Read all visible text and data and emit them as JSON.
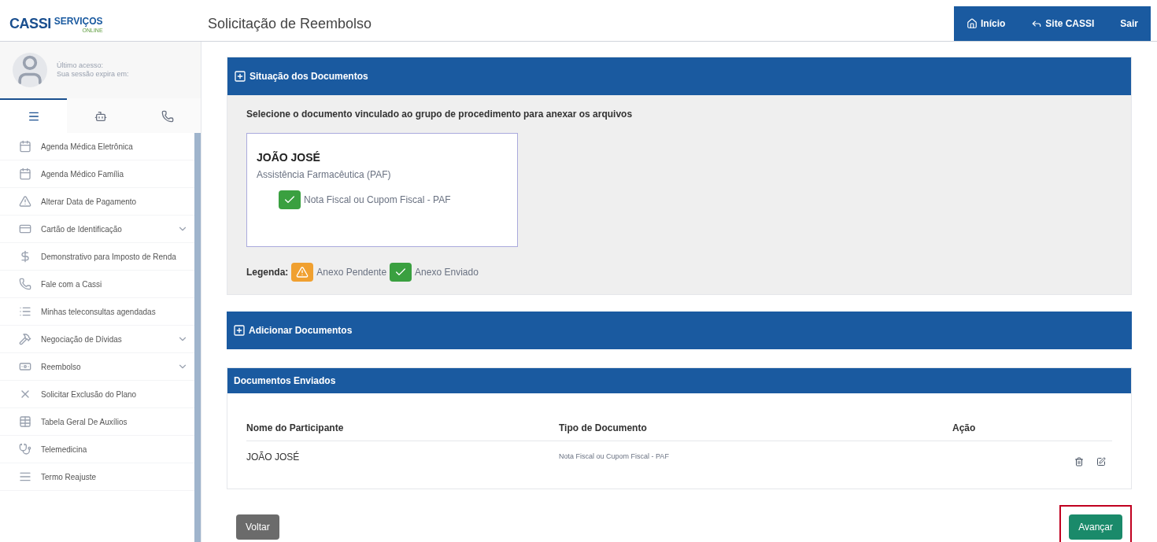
{
  "header": {
    "logo_main": "CASSI",
    "logo_sub": "SERVIÇOS",
    "logo_tag": "ONLINE",
    "title": "Solicitação de Reembolso",
    "nav": [
      {
        "label": "Início"
      },
      {
        "label": "Site CASSI"
      },
      {
        "label": "Sair"
      }
    ]
  },
  "user": {
    "line_1": "Último acesso:",
    "line_2": "Sua sessão expira em:"
  },
  "sidebar_tabs": [
    {
      "selected": true
    },
    {
      "selected": false
    },
    {
      "selected": false
    }
  ],
  "sidebar": {
    "items": [
      {
        "label": "Agenda Médica Eletrônica",
        "has_submenu": false
      },
      {
        "label": "Agenda Médico Família",
        "has_submenu": false
      },
      {
        "label": "Alterar Data de Pagamento",
        "has_submenu": false
      },
      {
        "label": "Cartão de Identificação",
        "has_submenu": true
      },
      {
        "label": "Demonstrativo para Imposto de Renda",
        "has_submenu": false
      },
      {
        "label": "Fale com a Cassi",
        "has_submenu": false
      },
      {
        "label": "Minhas teleconsultas agendadas",
        "has_submenu": false
      },
      {
        "label": "Negociação de Dívidas",
        "has_submenu": true
      },
      {
        "label": "Reembolso",
        "has_submenu": true
      },
      {
        "label": "Solicitar Exclusão do Plano",
        "has_submenu": false
      },
      {
        "label": "Tabela Geral De Auxílios",
        "has_submenu": false
      },
      {
        "label": "Telemedicina",
        "has_submenu": false
      },
      {
        "label": "Termo Reajuste",
        "has_submenu": false
      }
    ]
  },
  "situacao": {
    "title": "Situação dos Documentos",
    "instruction": "Selecione o documento vinculado ao grupo de procedimento para anexar os arquivos",
    "card": {
      "name": "JOÃO JOSÉ",
      "group": "Assistência Farmacêutica (PAF)",
      "documents": [
        {
          "label": "Nota Fiscal ou Cupom Fiscal - PAF",
          "kind": "sent"
        }
      ]
    },
    "legend_label": "Legenda:",
    "legend": [
      {
        "label": "Anexo Pendente",
        "kind": "pending"
      },
      {
        "label": "Anexo Enviado",
        "kind": "sent"
      }
    ]
  },
  "adicionar": {
    "title": "Adicionar Documentos"
  },
  "enviados": {
    "title": "Documentos Enviados",
    "columns": [
      "Nome do Participante",
      "Tipo de Documento",
      "Ação"
    ],
    "rows": [
      {
        "participant": "JOÃO JOSÉ",
        "type": "Nota Fiscal ou Cupom Fiscal - PAF"
      }
    ]
  },
  "buttons": {
    "back": "Voltar",
    "next": "Avançar",
    "next_highlighted": true
  }
}
